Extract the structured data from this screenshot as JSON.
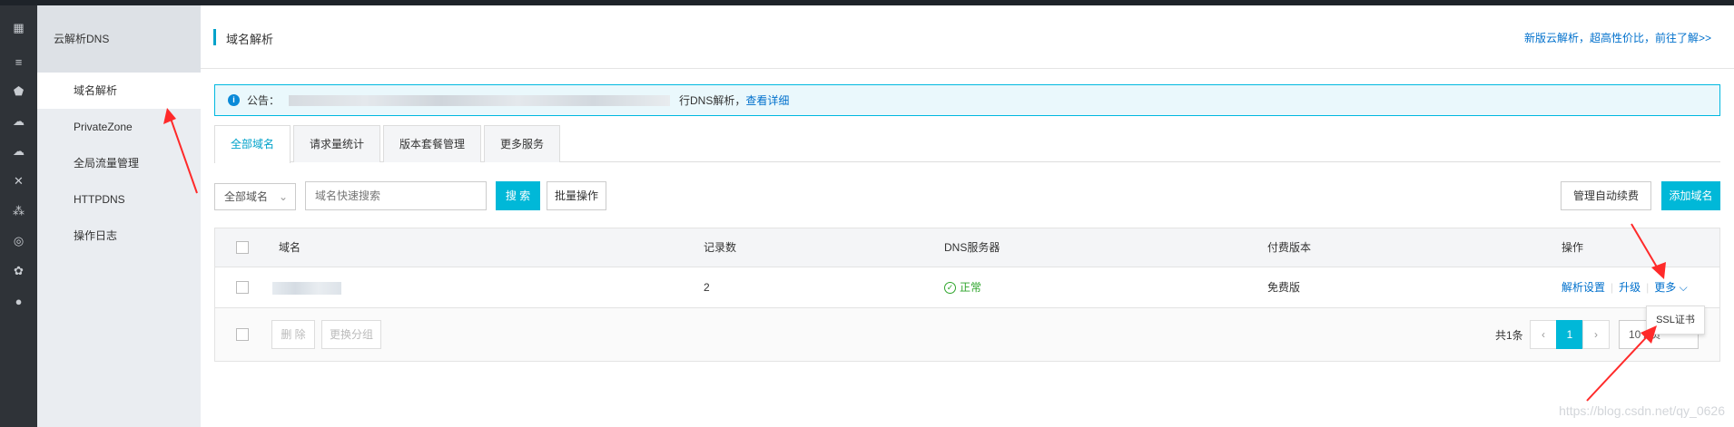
{
  "nav": {
    "title": "云解析DNS",
    "items": [
      {
        "label": "域名解析",
        "active": true
      },
      {
        "label": "PrivateZone"
      },
      {
        "label": "全局流量管理"
      },
      {
        "label": "HTTPDNS"
      },
      {
        "label": "操作日志"
      }
    ]
  },
  "header": {
    "title": "域名解析",
    "promo": "新版云解析，超高性价比，前往了解>>"
  },
  "notice": {
    "prefix": "公告：",
    "text_tail": "行DNS解析，",
    "link": "查看详细"
  },
  "tabs": [
    "全部域名",
    "请求量统计",
    "版本套餐管理",
    "更多服务"
  ],
  "toolbar": {
    "filter": "全部域名",
    "search_placeholder": "域名快速搜索",
    "search_btn": "搜 索",
    "batch_btn": "批量操作",
    "auto_renew_btn": "管理自动续费",
    "add_btn": "添加域名"
  },
  "table": {
    "headers": {
      "domain": "域名",
      "records": "记录数",
      "dns": "DNS服务器",
      "plan": "付费版本",
      "ops": "操作"
    },
    "rows": [
      {
        "records": "2",
        "dns": "正常",
        "plan": "免费版",
        "op1": "解析设置",
        "op2": "升级",
        "op3": "更多"
      }
    ],
    "delete_btn": "删 除",
    "group_btn": "更换分组",
    "total": "共1条",
    "page": "1",
    "page_size": "10 / 页"
  },
  "dropdown": {
    "item": "SSL证书"
  },
  "watermark": "https://blog.csdn.net/qy_0626",
  "colors": {
    "accent": "#00b8d8",
    "link": "#0070cc",
    "arrow": "#ff2a2a",
    "ok": "#2fa52c"
  }
}
